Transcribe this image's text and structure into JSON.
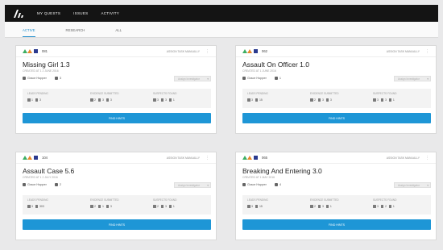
{
  "nav": {
    "items": [
      "MY QUESTS",
      "ISSUES",
      "ACTIVITY"
    ]
  },
  "tabs": [
    "ACTIVE",
    "RESEARCH",
    "ALL"
  ],
  "cards": [
    {
      "id": "081",
      "title": "Missing Girl 1.3",
      "subtitle": "Created at 1 2 june 2016",
      "head_link": "Assign Task Manually",
      "user": "Grace Hopper",
      "count": "3",
      "assign_placeholder": "Assign Investigator",
      "stats": [
        {
          "label": "Leads Pending",
          "values": [
            "1",
            "3"
          ]
        },
        {
          "label": "Evidence Submitted",
          "values": [
            "2",
            "3",
            "3"
          ]
        },
        {
          "label": "Suspects Found",
          "values": [
            "3",
            "3",
            "1"
          ]
        }
      ],
      "button": "Find Hints"
    },
    {
      "id": "062",
      "title": "Assault On Officer 1.0",
      "subtitle": "Created at 1 june 2016",
      "head_link": "Assign Task Manually",
      "user": "Grace Hopper",
      "count": "1",
      "assign_placeholder": "Assign Investigator",
      "stats": [
        {
          "label": "Leads Pending",
          "values": [
            "3",
            "15"
          ]
        },
        {
          "label": "Evidence Submitted",
          "values": [
            "2",
            "3",
            "3"
          ]
        },
        {
          "label": "Suspects Found",
          "values": [
            "3",
            "3",
            "1"
          ]
        }
      ],
      "button": "Find Hints"
    },
    {
      "id": "104",
      "title": "Assault Case 5.6",
      "subtitle": "Created at 1 2 july 2016",
      "head_link": "Assign Task Manually",
      "user": "Grace Hopper",
      "count": "2",
      "assign_placeholder": "Assign Investigator",
      "stats": [
        {
          "label": "Leads Pending",
          "values": [
            "3",
            "303"
          ]
        },
        {
          "label": "Evidence Submitted",
          "values": [
            "2",
            "1",
            "3"
          ]
        },
        {
          "label": "Suspects Found",
          "values": [
            "2",
            "3",
            "1"
          ]
        }
      ],
      "button": "Find Hints"
    },
    {
      "id": "065",
      "title": "Breaking And Entering 3.0",
      "subtitle": "Created at 1 may 2016",
      "head_link": "Assign Task Manually",
      "user": "Grace Hopper",
      "count": "4",
      "assign_placeholder": "Assign Investigator",
      "stats": [
        {
          "label": "Leads Pending",
          "values": [
            "3",
            "15"
          ]
        },
        {
          "label": "Evidence Submitted",
          "values": [
            "2",
            "3",
            "1"
          ]
        },
        {
          "label": "Suspects Found",
          "values": [
            "3",
            "2",
            "1"
          ]
        }
      ],
      "button": "Find Hints"
    }
  ],
  "colors": {
    "topbar": "#141414",
    "accent": "#1e96d6",
    "status_green": "#3cae62",
    "status_orange": "#e88a2b",
    "status_navy": "#2b3a8e"
  }
}
